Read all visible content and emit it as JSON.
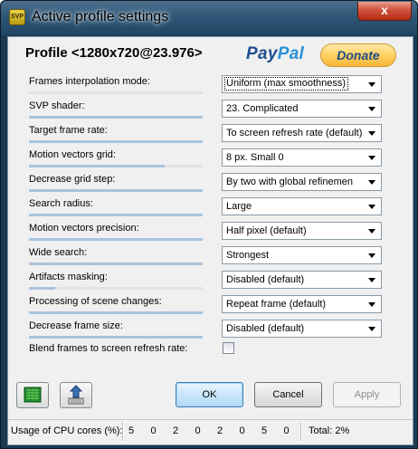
{
  "window": {
    "title": "Active profile settings",
    "icon_label": "SVP",
    "close_glyph": "x"
  },
  "header": {
    "profile": "Profile <1280x720@23.976>",
    "paypal_part1": "Pay",
    "paypal_part2": "Pal",
    "donate": "Donate"
  },
  "settings": [
    {
      "label": "Frames interpolation mode:",
      "value": "Uniform (max smoothness)",
      "level": 0.0
    },
    {
      "label": "SVP shader:",
      "value": "23. Complicated",
      "level": 1.0
    },
    {
      "label": "Target frame rate:",
      "value": "To screen refresh rate (default)",
      "level": 1.0
    },
    {
      "label": "Motion vectors grid:",
      "value": "8 px. Small 0",
      "level": 0.78
    },
    {
      "label": "Decrease grid step:",
      "value": "By two with global refinemen",
      "level": 1.0
    },
    {
      "label": "Search radius:",
      "value": "Large",
      "level": 1.0
    },
    {
      "label": "Motion vectors precision:",
      "value": "Half pixel (default)",
      "level": 1.0
    },
    {
      "label": "Wide search:",
      "value": "Strongest",
      "level": 1.0
    },
    {
      "label": "Artifacts masking:",
      "value": "Disabled (default)",
      "level": 0.15
    },
    {
      "label": "Processing of scene changes:",
      "value": "Repeat frame (default)",
      "level": 1.0
    },
    {
      "label": "Decrease frame size:",
      "value": "Disabled (default)",
      "level": 1.0
    }
  ],
  "blend": {
    "label": "Blend frames to screen refresh rate:",
    "checked": false
  },
  "buttons": {
    "ok": "OK",
    "cancel": "Cancel",
    "apply": "Apply"
  },
  "status": {
    "label": "Usage of CPU cores (%):",
    "cores": [
      "5",
      "0",
      "2",
      "0",
      "2",
      "0",
      "5",
      "0"
    ],
    "total": "Total: 2%"
  },
  "colors": {
    "title_bar": "#2f5676",
    "close": "#c8412a",
    "slider_fill": "#a9c3dc",
    "default_button": "#c9e6fa"
  }
}
